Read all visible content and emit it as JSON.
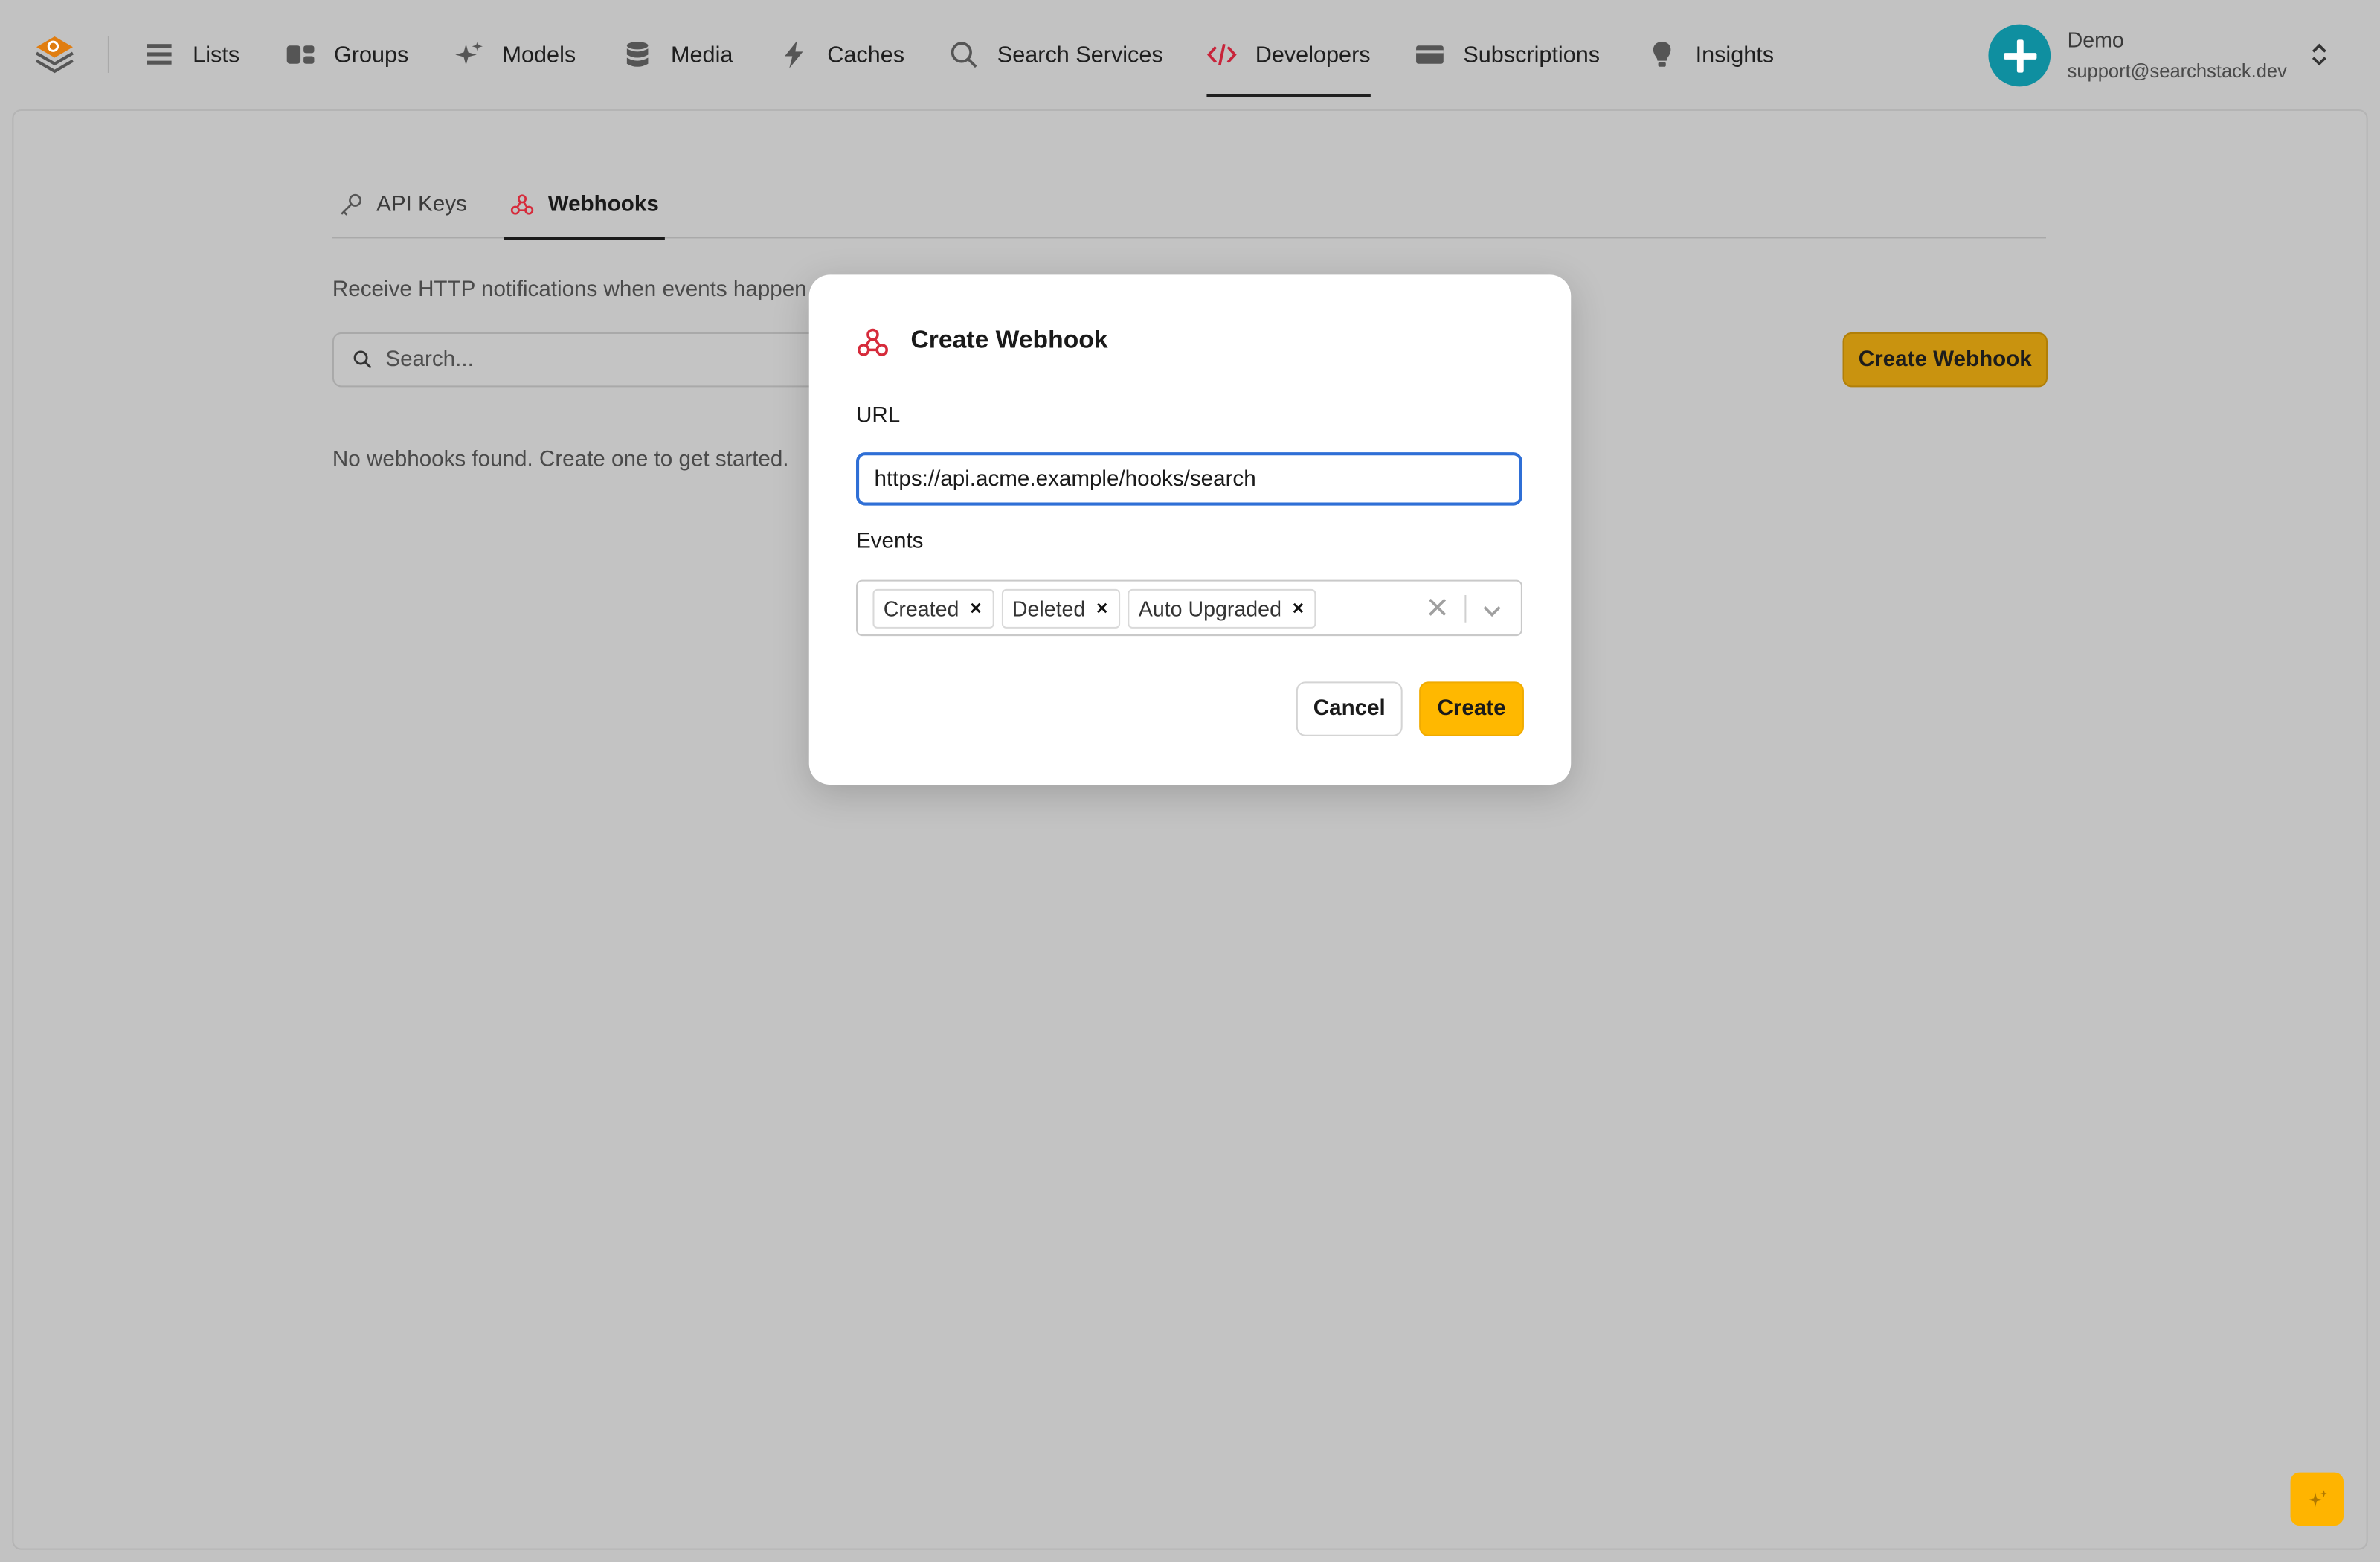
{
  "nav": {
    "items": [
      {
        "label": "Lists",
        "icon": "list-icon"
      },
      {
        "label": "Groups",
        "icon": "groups-icon"
      },
      {
        "label": "Models",
        "icon": "sparkles-icon"
      },
      {
        "label": "Media",
        "icon": "database-icon"
      },
      {
        "label": "Caches",
        "icon": "lightning-icon"
      },
      {
        "label": "Search Services",
        "icon": "search-icon"
      },
      {
        "label": "Developers",
        "icon": "code-icon",
        "active": true
      },
      {
        "label": "Subscriptions",
        "icon": "credit-card-icon"
      },
      {
        "label": "Insights",
        "icon": "lightbulb-icon"
      }
    ]
  },
  "user": {
    "name": "Demo",
    "email": "support@searchstack.dev"
  },
  "tabs": [
    {
      "label": "API Keys",
      "icon": "key-icon"
    },
    {
      "label": "Webhooks",
      "icon": "webhook-icon",
      "active": true
    }
  ],
  "page": {
    "description": "Receive HTTP notifications when events happen",
    "search_placeholder": "Search...",
    "empty_message": "No webhooks found. Create one to get started.",
    "create_button": "Create Webhook"
  },
  "modal": {
    "title": "Create Webhook",
    "url_label": "URL",
    "url_value": "https://api.acme.example/hooks/search",
    "events_label": "Events",
    "events": [
      "Created",
      "Deleted",
      "Auto Upgraded"
    ],
    "cancel_label": "Cancel",
    "create_label": "Create"
  },
  "colors": {
    "accent": "#ffb800",
    "accent_dim": "#c9930f",
    "focus_border": "#2f6fd6",
    "webhook_red": "#d62b3b",
    "avatar": "#0f8fa0"
  }
}
